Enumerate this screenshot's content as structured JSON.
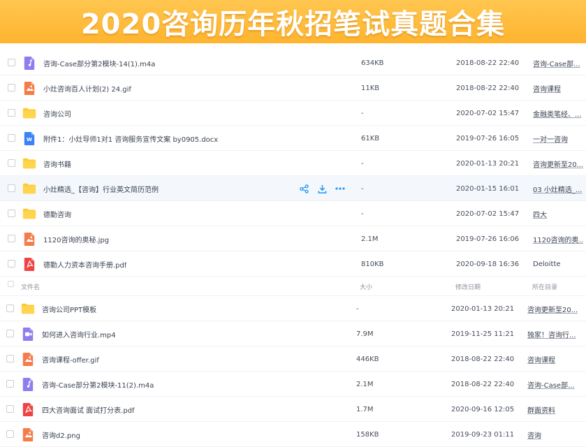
{
  "banner": {
    "title": "2020咨询历年秋招笔试真题合集"
  },
  "colors": {
    "banner": "#ffb42e",
    "folder": "#ffc933",
    "image": "#f57c4a",
    "audio": "#8c7ef0",
    "video": "#8c7ef0",
    "word": "#3b82f6",
    "pdf": "#ef4444",
    "action": "#2196f3"
  },
  "list_a": [
    {
      "type": "audio",
      "name": "咨询-Case部分第2模块-14(1).m4a",
      "size": "634KB",
      "date": "2018-08-22 22:40",
      "location": "咨询-Case部..."
    },
    {
      "type": "image",
      "name": "小灶咨询百人计划(2)  24.gif",
      "size": "11KB",
      "date": "2018-08-22 22:40",
      "location": "咨询课程"
    },
    {
      "type": "folder",
      "name": "咨询公司",
      "size": "-",
      "date": "2020-07-02 15:47",
      "location": "金融类笔经、..."
    },
    {
      "type": "word",
      "name": "附件1：小灶导师1对1 咨询服务宣传文案 by0905.docx",
      "size": "61KB",
      "date": "2019-07-26 16:05",
      "location": "一对一咨询"
    },
    {
      "type": "folder",
      "name": "咨询书籍",
      "size": "-",
      "date": "2020-01-13 20:21",
      "location": "咨询更新至20..."
    },
    {
      "type": "folder",
      "name": "小灶精选_【咨询】行业英文简历范例",
      "size": "-",
      "date": "2020-01-15 16:01",
      "location": "03 小灶精选_..."
    },
    {
      "type": "folder",
      "name": "德勤咨询",
      "size": "-",
      "date": "2020-07-02 15:47",
      "location": "四大"
    },
    {
      "type": "image",
      "name": "1120咨询的奥秘.jpg",
      "size": "2.1M",
      "date": "2019-07-26 16:06",
      "location": "1120咨询的奥..."
    },
    {
      "type": "pdf",
      "name": "德勤人力资本咨询手册.pdf",
      "size": "810KB",
      "date": "2020-09-18 16:36",
      "location": "Deloitte"
    }
  ],
  "header": {
    "name": "文件名",
    "size": "大小",
    "date": "修改日期",
    "location": "所在目录"
  },
  "list_b": [
    {
      "type": "folder",
      "name": "咨询公司PPT模板",
      "size": "-",
      "date": "2020-01-13 20:21",
      "location": "咨询更新至20..."
    },
    {
      "type": "video",
      "name": "如何进入咨询行业.mp4",
      "size": "7.9M",
      "date": "2019-11-25 11:21",
      "location": "独家！咨询行..."
    },
    {
      "type": "image",
      "name": "咨询课程-offer.gif",
      "size": "446KB",
      "date": "2018-08-22 22:40",
      "location": "咨询课程"
    },
    {
      "type": "audio",
      "name": "咨询-Case部分第2模块-11(2).m4a",
      "size": "2.1M",
      "date": "2018-08-22 22:40",
      "location": "咨询-Case部..."
    },
    {
      "type": "pdf",
      "name": "四大咨询面试 面试打分表.pdf",
      "size": "1.7M",
      "date": "2020-09-16 12:05",
      "location": "群面资料"
    },
    {
      "type": "image",
      "name": "咨询d2.png",
      "size": "158KB",
      "date": "2019-09-23 01:11",
      "location": "咨询"
    }
  ],
  "hover_row_index": 5,
  "hover_actions": [
    {
      "icon": "share-icon"
    },
    {
      "icon": "download-icon"
    },
    {
      "icon": "more-icon"
    }
  ]
}
